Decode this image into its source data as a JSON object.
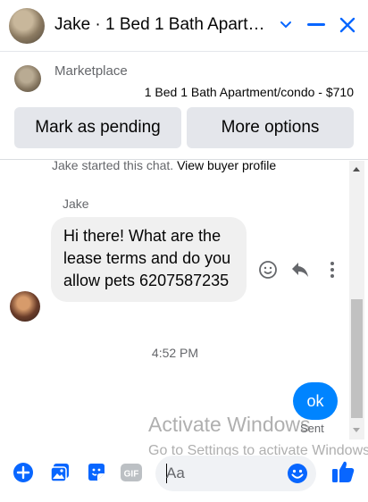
{
  "header": {
    "title": "Jake · 1 Bed 1 Bath Apartm...",
    "minimize_icon": "chevron-down-icon",
    "collapse_icon": "minus-icon",
    "close_icon": "close-icon"
  },
  "listing": {
    "source": "Marketplace",
    "title": "1 Bed 1 Bath Apartment/condo - $710",
    "buttons": [
      "Mark as pending",
      "More options"
    ]
  },
  "conversation": {
    "system_note": "Jake started this chat.",
    "system_link": "View buyer profile",
    "incoming": {
      "sender": "Jake",
      "text": "Hi there! What are the lease terms and do you allow pets 6207587235"
    },
    "message_actions": [
      "emoji-react-icon",
      "reply-icon",
      "more-icon"
    ],
    "timestamp": "4:52 PM",
    "outgoing": {
      "text": "ok",
      "status": "Sent"
    }
  },
  "watermark": {
    "line1": "Activate Windows",
    "line2": "Go to Settings to activate Windows."
  },
  "composer": {
    "placeholder": "Aa",
    "icons": [
      "plus-icon",
      "photo-icon",
      "sticker-icon",
      "gif-icon",
      "emoji-icon",
      "thumbs-up-icon"
    ]
  },
  "colors": {
    "accent": "#0084ff",
    "bubble_gray": "#f0f0f0",
    "button_gray": "#e4e6eb"
  }
}
